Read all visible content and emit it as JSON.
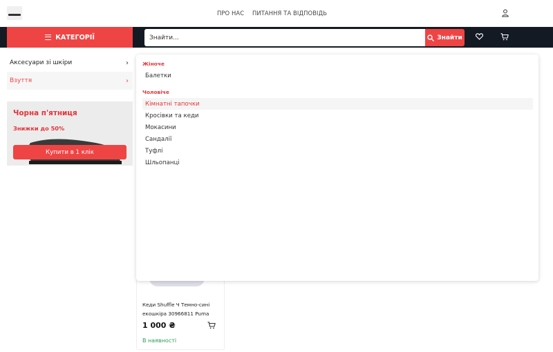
{
  "header": {
    "nav": [
      "ПРО НАС",
      "ПИТАННЯ ТА ВІДПОВІДЬ"
    ]
  },
  "toolbar": {
    "categories_label": "КАТЕГОРІЇ",
    "search_placeholder": "Знайти...",
    "search_button": "Знайти"
  },
  "sidebar": {
    "items": [
      {
        "label": "Аксесуари зі шкіри"
      },
      {
        "label": "Взуття"
      }
    ]
  },
  "promo": {
    "title": "Чорна п'ятниця",
    "subtitle": "Знижки до 50%",
    "button": "Купити в 1 клік"
  },
  "dropdown": {
    "women_heading": "Жіноче",
    "women_items": [
      "Балетки"
    ],
    "men_heading": "Чоловіче",
    "men_items": [
      "Кімнатні тапочки",
      "Кросівки та кеди",
      "Мокасини",
      "Сандалії",
      "Туфлі",
      "Шльопанці"
    ]
  },
  "product": {
    "name": "Кеди Shuffle Ч Темно-сині екошкіра 30966811 Puma",
    "price": "1 000 ₴",
    "stock": "В наявності"
  },
  "colors": {
    "accent": "#ef4444",
    "dark_bar": "#141a24",
    "in_stock": "#2e9c55"
  },
  "icons": [
    "user-icon",
    "search-icon",
    "heart-icon",
    "cart-icon",
    "chevron-right-icon",
    "menu-icon"
  ]
}
